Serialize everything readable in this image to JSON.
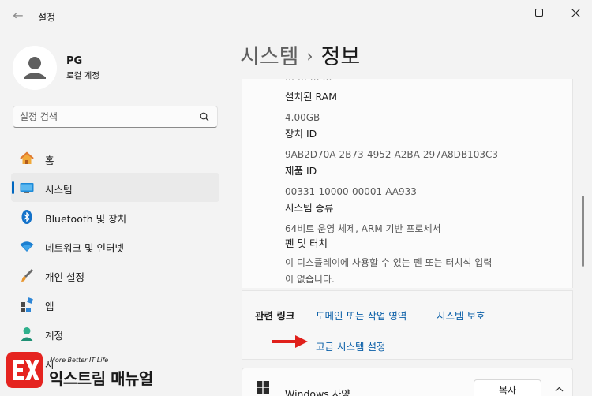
{
  "window": {
    "title": "설정",
    "back_icon": "←"
  },
  "profile": {
    "name": "PG",
    "account_type": "로컬 계정"
  },
  "search": {
    "placeholder": "설정 검색"
  },
  "nav": {
    "items": [
      {
        "label": "홈",
        "icon": "home-icon"
      },
      {
        "label": "시스템",
        "icon": "monitor-icon",
        "active": true
      },
      {
        "label": "Bluetooth 및 장치",
        "icon": "bluetooth-icon"
      },
      {
        "label": "네트워크 및 인터넷",
        "icon": "wifi-icon"
      },
      {
        "label": "개인 설정",
        "icon": "brush-icon"
      },
      {
        "label": "앱",
        "icon": "apps-icon"
      },
      {
        "label": "계정",
        "icon": "person-icon"
      },
      {
        "label": "시",
        "icon": "clock-icon"
      }
    ]
  },
  "header": {
    "parent": "시스템",
    "separator": "›",
    "current": "정보"
  },
  "specs": {
    "cutoff_text": "… … … …",
    "items": [
      {
        "label": "설치된 RAM",
        "value": "4.00GB"
      },
      {
        "label": "장치 ID",
        "value": "9AB2D70A-2B73-4952-A2BA-297A8DB103C3"
      },
      {
        "label": "제품 ID",
        "value": "00331-10000-00001-AA933"
      },
      {
        "label": "시스템 종류",
        "value": "64비트 운영 체제, ARM 기반 프로세서"
      },
      {
        "label": "펜 및 터치",
        "value_line1": "이 디스플레이에 사용할 수 있는 펜 또는 터치식 입력",
        "value_line2": "이 없습니다."
      }
    ]
  },
  "related_links": {
    "title": "관련 링크",
    "domain": "도메인 또는 작업 영역",
    "protection": "시스템 보호",
    "advanced": "고급 시스템 설정"
  },
  "windows_spec": {
    "title": "Windows 사양",
    "copy_label": "복사"
  },
  "watermark": {
    "logo_letters": "EX",
    "tagline": "More Better IT Life",
    "name": "익스트림 매뉴얼"
  },
  "colors": {
    "accent": "#0067c0",
    "link": "#0a5fa8",
    "arrow": "#e0201b",
    "watermark": "#e52420"
  }
}
